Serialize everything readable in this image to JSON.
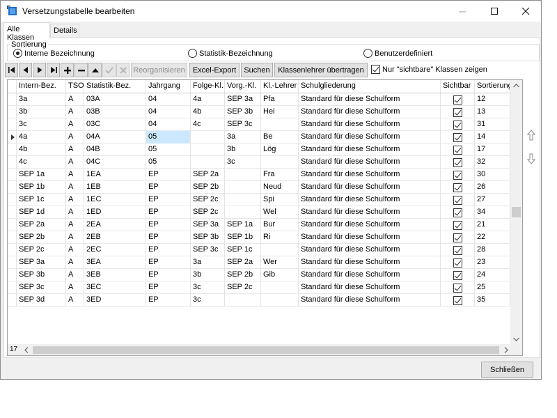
{
  "window": {
    "title": "Versetzungstabelle bearbeiten",
    "minimize_glyph": "—",
    "close_glyph": "✕"
  },
  "tabs": [
    {
      "label": "Alle Klassen",
      "active": true
    },
    {
      "label": "Details",
      "active": false
    }
  ],
  "sorting": {
    "legend": "Sortierung",
    "options": [
      {
        "label": "Interne Bezeichnung",
        "selected": true
      },
      {
        "label": "Statistik-Bezeichnung",
        "selected": false
      },
      {
        "label": "Benutzerdefiniert",
        "selected": false
      }
    ]
  },
  "toolbar": {
    "reorganize": "Reorganisieren",
    "excel_export": "Excel-Export",
    "search": "Suchen",
    "transfer_teachers": "Klassenlehrer übertragen",
    "visible_only_label": "Nur \"sichtbare\" Klassen zeigen",
    "visible_only_checked": true
  },
  "grid": {
    "columns": [
      "Intern-Bez.",
      "TSO",
      "Statistik-Bez.",
      "Jahrgang",
      "Folge-Kl.",
      "Vorg.-Kl.",
      "Kl.-Lehrer",
      "Schulgliederung",
      "Sichtbar",
      "Sortierung"
    ],
    "rows": [
      [
        "3a",
        "A",
        "03A",
        "04",
        "4a",
        "SEP 3a",
        "Pfa",
        "Standard für diese Schulform",
        true,
        "12"
      ],
      [
        "3b",
        "A",
        "03B",
        "04",
        "4b",
        "SEP 3b",
        "Hei",
        "Standard für diese Schulform",
        true,
        "13"
      ],
      [
        "3c",
        "A",
        "03C",
        "04",
        "4c",
        "SEP 3c",
        "",
        "Standard für diese Schulform",
        true,
        "31"
      ],
      [
        "4a",
        "A",
        "04A",
        "05",
        "",
        "3a",
        "Be",
        "Standard für diese Schulform",
        true,
        "14"
      ],
      [
        "4b",
        "A",
        "04B",
        "05",
        "",
        "3b",
        "Lög",
        "Standard für diese Schulform",
        true,
        "17"
      ],
      [
        "4c",
        "A",
        "04C",
        "05",
        "",
        "3c",
        "",
        "Standard für diese Schulform",
        true,
        "32"
      ],
      [
        "SEP 1a",
        "A",
        "1EA",
        "EP",
        "SEP 2a",
        "",
        "Fra",
        "Standard für diese Schulform",
        true,
        "30"
      ],
      [
        "SEP 1b",
        "A",
        "1EB",
        "EP",
        "SEP 2b",
        "",
        "Neud",
        "Standard für diese Schulform",
        true,
        "26"
      ],
      [
        "SEP 1c",
        "A",
        "1EC",
        "EP",
        "SEP 2c",
        "",
        "Spi",
        "Standard für diese Schulform",
        true,
        "27"
      ],
      [
        "SEP 1d",
        "A",
        "1ED",
        "EP",
        "SEP 2c",
        "",
        "Wel",
        "Standard für diese Schulform",
        true,
        "34"
      ],
      [
        "SEP 2a",
        "A",
        "2EA",
        "EP",
        "SEP 3a",
        "SEP 1a",
        "Bur",
        "Standard für diese Schulform",
        true,
        "21"
      ],
      [
        "SEP 2b",
        "A",
        "2EB",
        "EP",
        "SEP 3b",
        "SEP 1b",
        "Ri",
        "Standard für diese Schulform",
        true,
        "22"
      ],
      [
        "SEP 2c",
        "A",
        "2EC",
        "EP",
        "SEP 3c",
        "SEP 1c",
        "",
        "Standard für diese Schulform",
        true,
        "28"
      ],
      [
        "SEP 3a",
        "A",
        "3EA",
        "EP",
        "3a",
        "SEP 2a",
        "Wer",
        "Standard für diese Schulform",
        true,
        "23"
      ],
      [
        "SEP 3b",
        "A",
        "3EB",
        "EP",
        "3b",
        "SEP 2b",
        "Gib",
        "Standard für diese Schulform",
        true,
        "24"
      ],
      [
        "SEP 3c",
        "A",
        "3EC",
        "EP",
        "3c",
        "SEP 2c",
        "",
        "Standard für diese Schulform",
        true,
        "25"
      ],
      [
        "SEP 3d",
        "A",
        "3ED",
        "EP",
        "3c",
        "",
        "",
        "Standard für diese Schulform",
        true,
        "35"
      ]
    ],
    "current_row": 3,
    "focused_column": 3,
    "record_count": "17"
  },
  "footer": {
    "close_label": "Schließen"
  },
  "colors": {
    "focus_cell": "#cce8ff",
    "title_icon": "#1e6fc8"
  }
}
